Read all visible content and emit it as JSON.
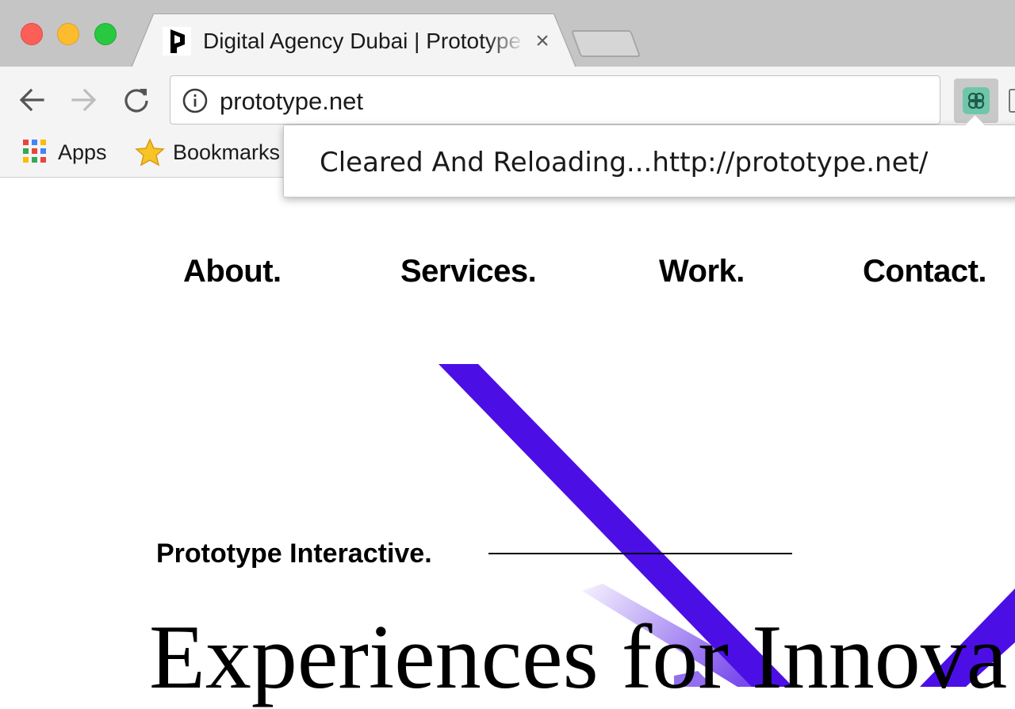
{
  "browser": {
    "tab": {
      "title": "Digital Agency Dubai | Prototype",
      "close_glyph": "×"
    },
    "omnibox": {
      "url": "prototype.net",
      "icon": "info-icon"
    },
    "buttons": {
      "back": "back-arrow-icon",
      "forward": "forward-arrow-icon",
      "reload": "reload-icon"
    },
    "bookmarks": [
      {
        "label": "Apps",
        "icon": "apps-grid-icon"
      },
      {
        "label": "Bookmarks",
        "icon": "star-icon"
      }
    ],
    "extension_icon": "cache-killer-icon"
  },
  "popup": {
    "message": "Cleared And Reloading...http://prototype.net/"
  },
  "site": {
    "nav": [
      "About.",
      "Services.",
      "Work.",
      "Contact."
    ],
    "brand": "Prototype Interactive.",
    "headline": "Experiences for Innova",
    "accent_color": "#4b0fe6"
  }
}
